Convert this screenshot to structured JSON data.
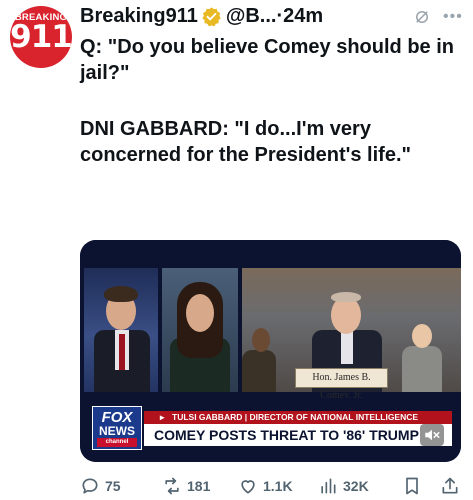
{
  "account": {
    "avatar_top": "BREAKING",
    "avatar_num": "911",
    "name": "Breaking911",
    "handle": "@B...",
    "dot": "·",
    "time": "24m"
  },
  "tweet": {
    "line1": "Q: \"Do you believe Comey should be in jail?\"",
    "line2": "DNI GABBARD: \"I do...I'm very concerned for the President's life.\""
  },
  "media": {
    "nameplate": "Hon. James B. Comey, Jr.",
    "logo_fox": "FOX",
    "logo_news": "NEWS",
    "logo_channel": "channel",
    "chyron_top": "TULSI GABBARD | DIRECTOR OF NATIONAL INTELLIGENCE",
    "chyron_main": "COMEY POSTS THREAT TO '86' TRUMP"
  },
  "actions": {
    "replies": "75",
    "reposts": "181",
    "likes": "1.1K",
    "views": "32K"
  },
  "colors": {
    "text": "#0f1419",
    "muted": "#536471",
    "brand_red": "#d9232d",
    "verified_gold": "#e8b923",
    "fox_blue": "#1b3a8c",
    "chyron_red": "#b1121b"
  },
  "icons": [
    "verified-badge-icon",
    "mute-icon",
    "more-icon",
    "reply-icon",
    "repost-icon",
    "like-icon",
    "views-icon",
    "bookmark-icon",
    "share-icon",
    "speaker-mute-icon"
  ]
}
